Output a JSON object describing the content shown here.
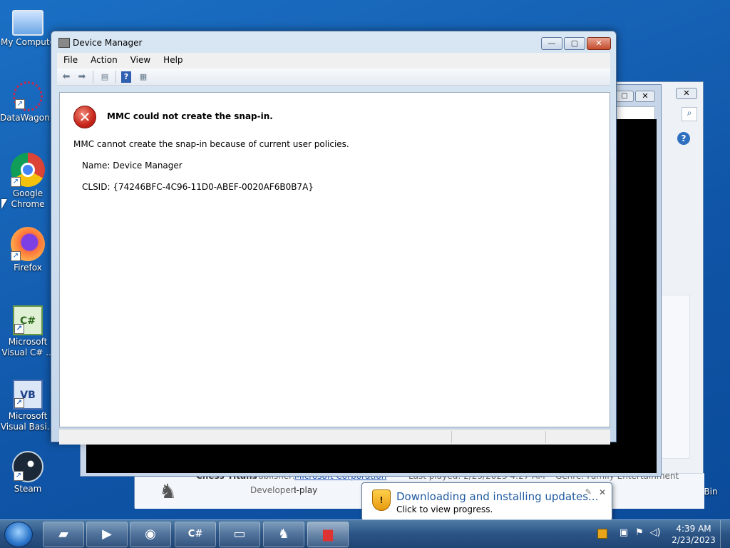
{
  "desktop": {
    "icons": [
      {
        "label": "My Compute",
        "glyph": "🖥"
      },
      {
        "label": "DataWagon...",
        "glyph": "✺"
      },
      {
        "label": "Google Chrome",
        "glyph": "●"
      },
      {
        "label": "Firefox",
        "glyph": "🦊"
      },
      {
        "label": "Microsoft Visual C# ...",
        "glyph": "C#"
      },
      {
        "label": "Microsoft Visual Basi...",
        "glyph": "VB"
      },
      {
        "label": "Steam",
        "glyph": "◉"
      }
    ],
    "recycle_bin_label": "Bin"
  },
  "background_window": {
    "details": {
      "title_partial": "Chess Titans",
      "publisher_label": "Publisher:",
      "publisher_value": "Microsoft Corporation",
      "developer_label": "Developer:",
      "developer_value": "I-play",
      "last_played": "Last played: 2/23/2023 4:27 AM",
      "genre": "Genre: Family Entertainment"
    }
  },
  "window": {
    "title": "Device Manager",
    "menu": [
      "File",
      "Action",
      "View",
      "Help"
    ],
    "error": {
      "title": "MMC could not create the snap-in.",
      "message": "MMC cannot create the snap-in because of current user policies.",
      "name_line": "Name: Device Manager",
      "clsid_line": "CLSID: {74246BFC-4C96-11D0-ABEF-0020AF6B0B7A}"
    }
  },
  "notification": {
    "title": "Downloading and installing updates...",
    "subtitle": "Click to view progress."
  },
  "taskbar": {
    "clock_time": "4:39 AM",
    "clock_date": "2/23/2023"
  }
}
